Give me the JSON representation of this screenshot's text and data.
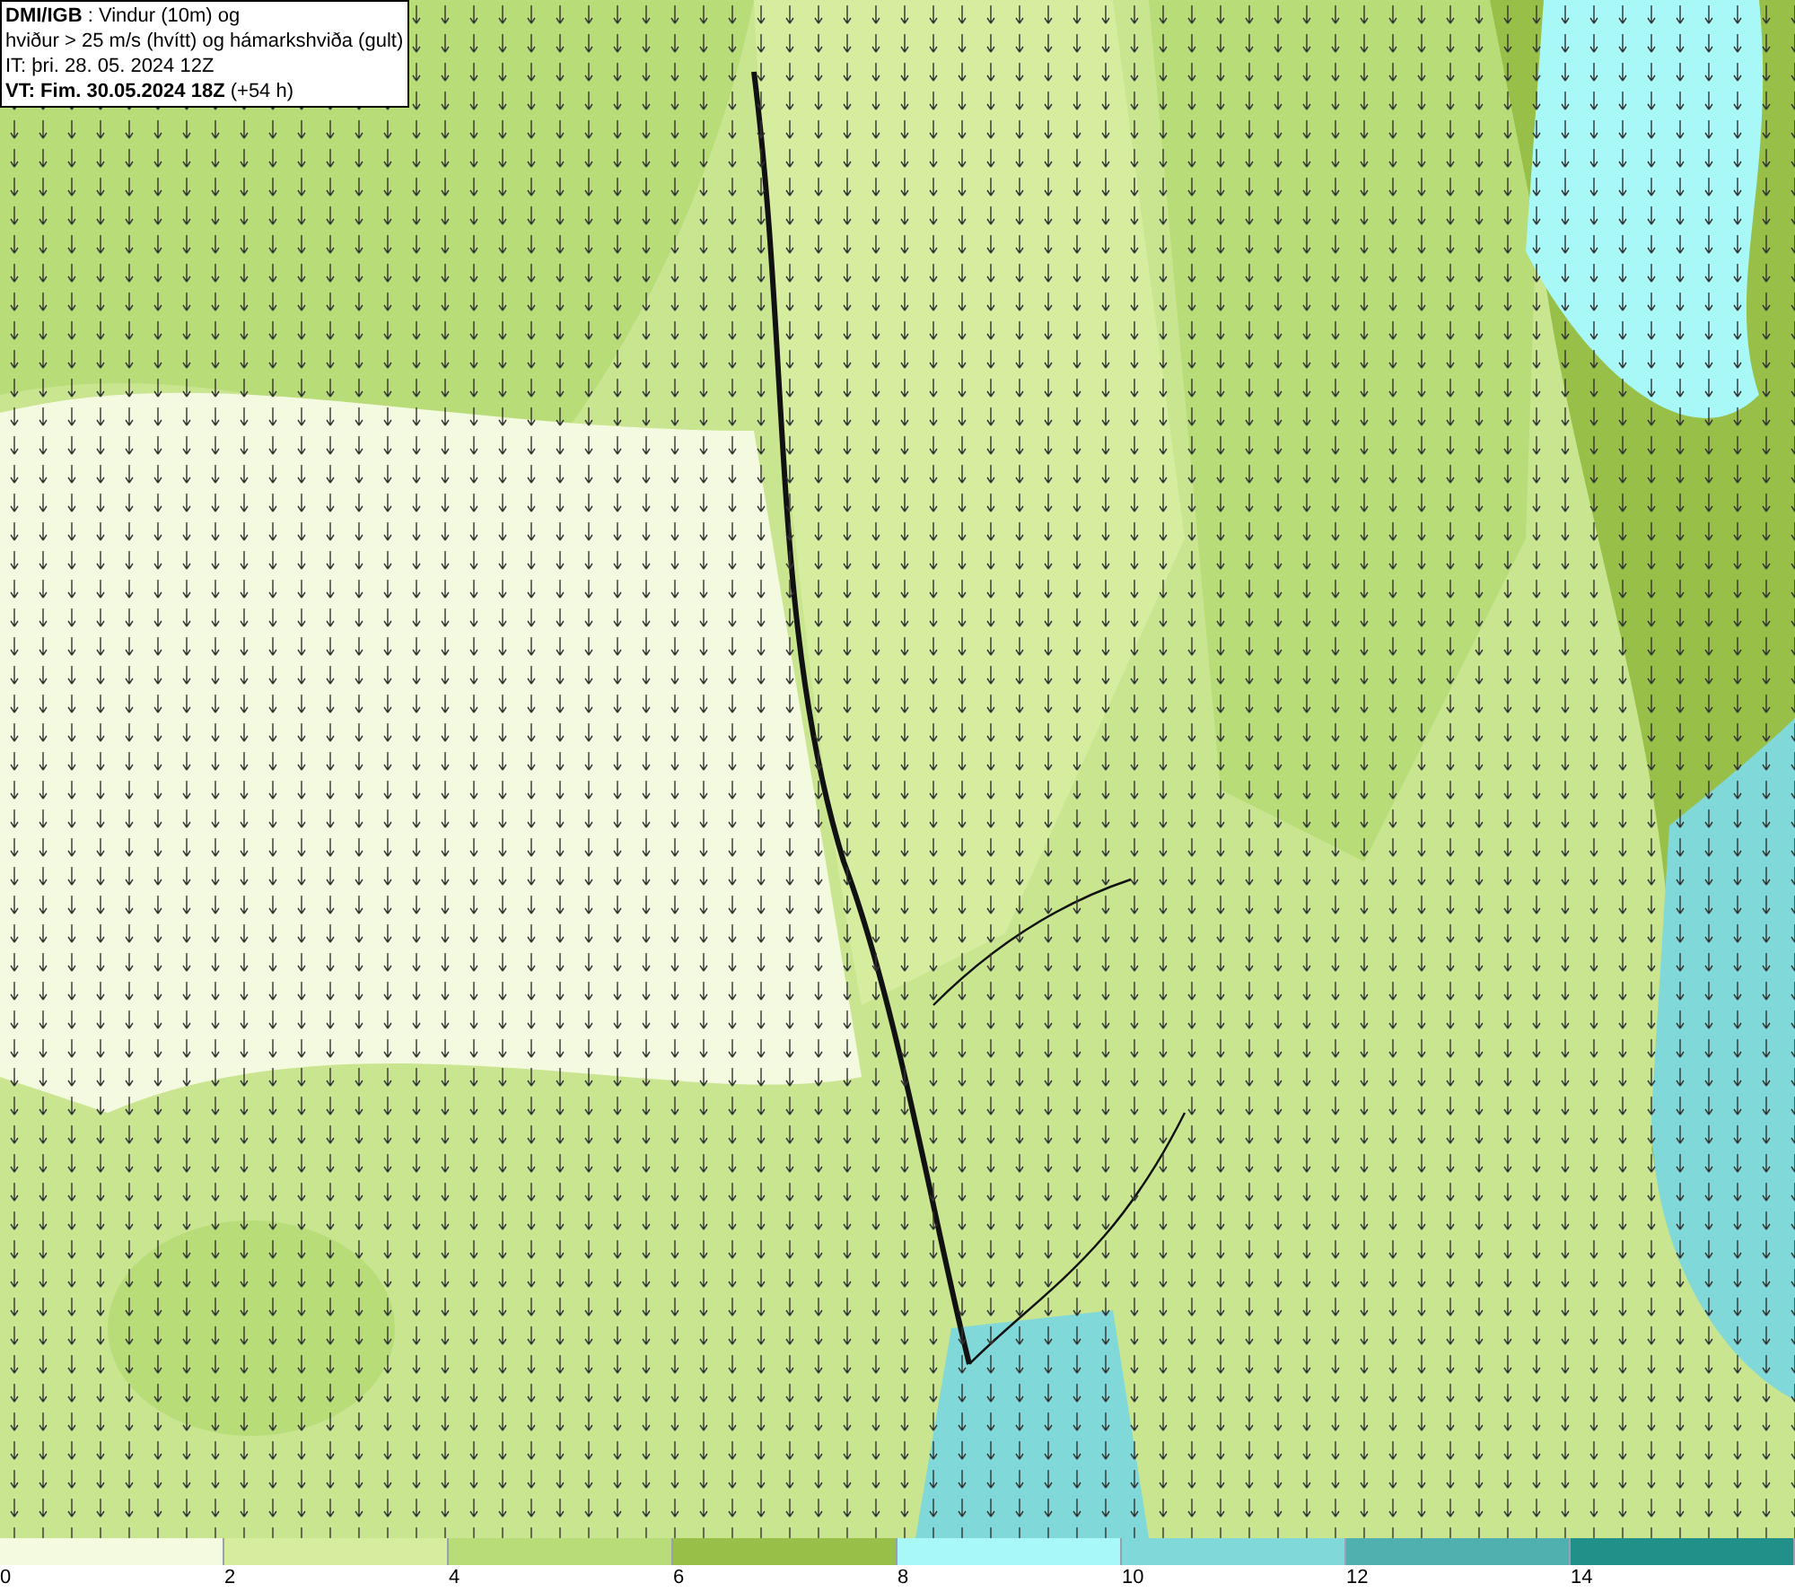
{
  "title_box": {
    "lines": [
      "**DMI/IGB** : Vindur (10m) og",
      "hviður > 25 m/s (hvítt) og hámarkshviða (gult)",
      "IT: þri. 28. 05. 2024 12Z",
      "**VT: Fim. 30.05.2024 18Z** (+54 h)"
    ]
  },
  "legend": {
    "bins": [
      {
        "label": "0",
        "color": "#f4fadf"
      },
      {
        "label": "2",
        "color": "#d6eda0"
      },
      {
        "label": "4",
        "color": "#b8dc78"
      },
      {
        "label": "6",
        "color": "#98bf48"
      },
      {
        "label": "8",
        "color": "#a8f8f8"
      },
      {
        "label": "10",
        "color": "#80d8d8"
      },
      {
        "label": "12",
        "color": "#50b0b0"
      },
      {
        "label": "14",
        "color": "#209088"
      }
    ]
  }
}
